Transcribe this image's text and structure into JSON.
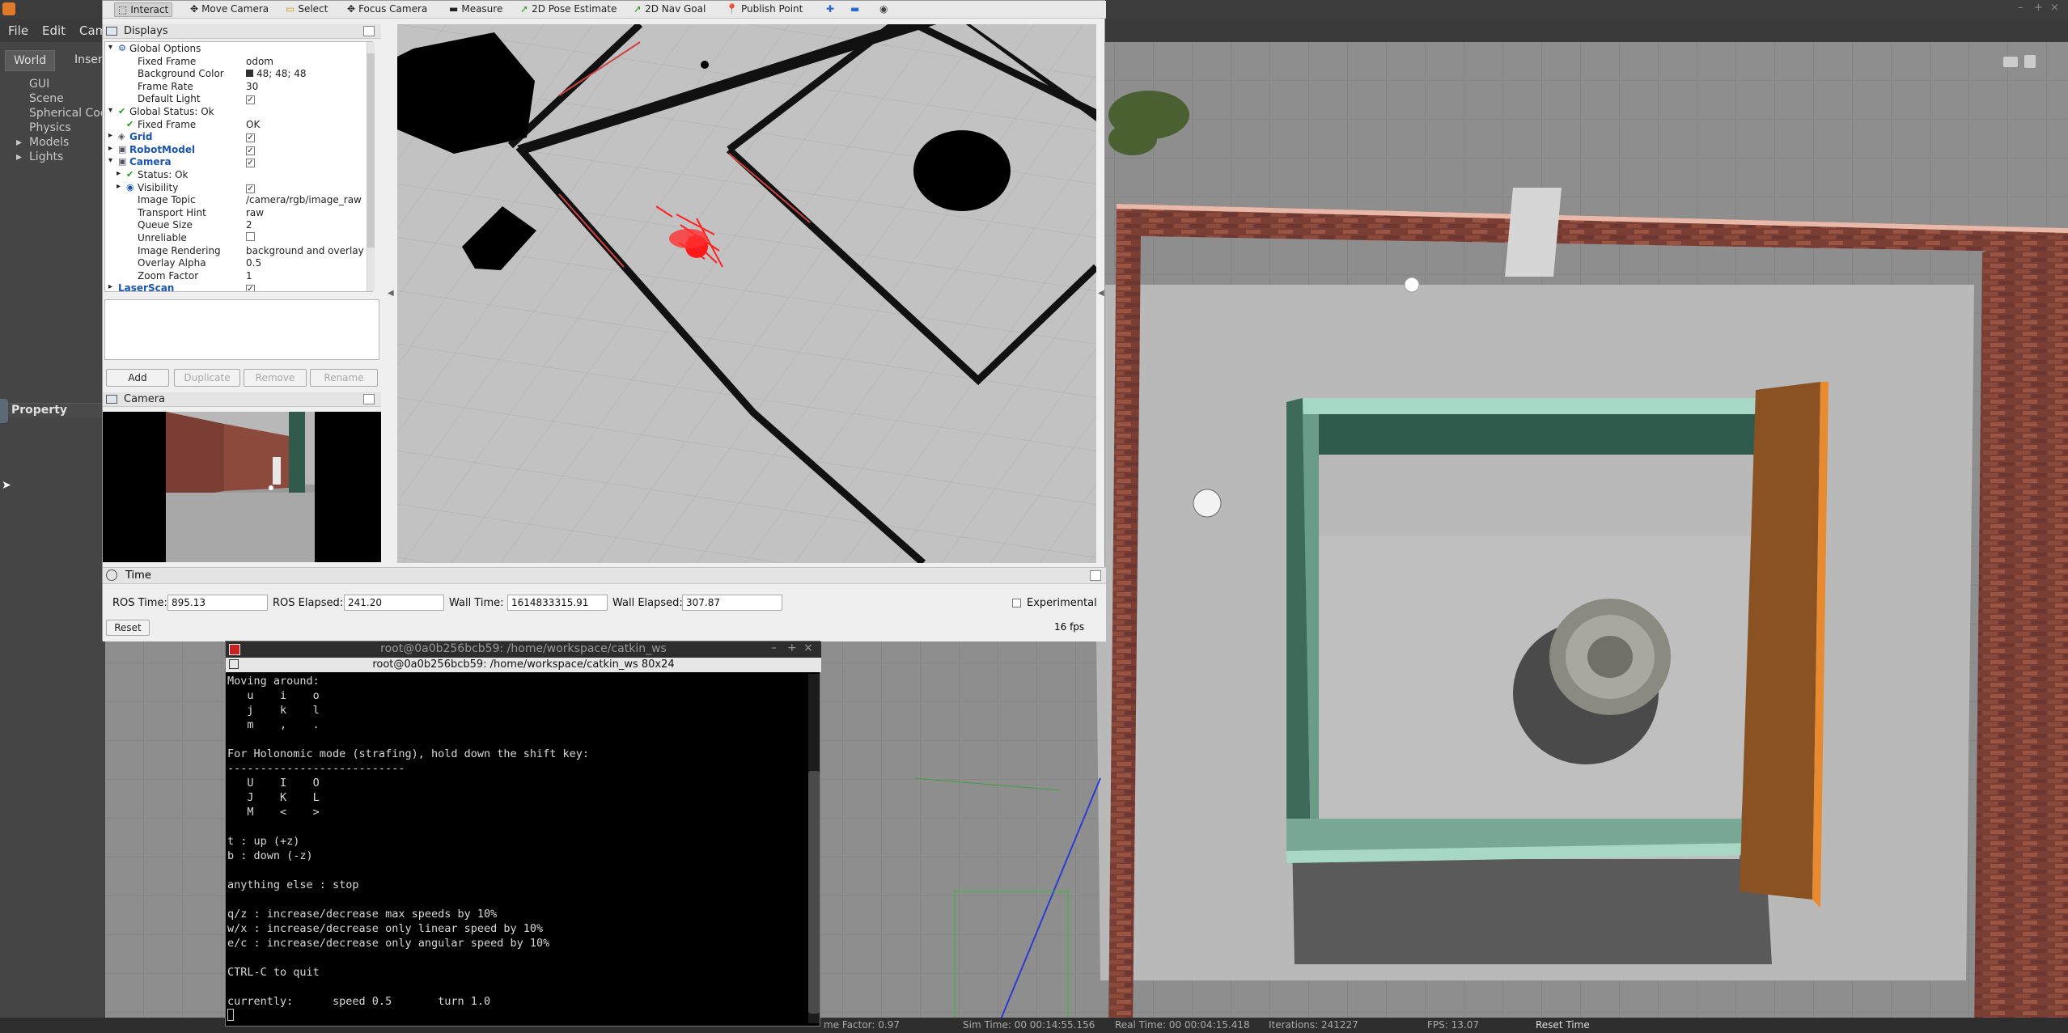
{
  "gazebo": {
    "menu": [
      "File",
      "Edit",
      "Cam"
    ],
    "tabs": [
      "World",
      "Inser"
    ],
    "tree": [
      "GUI",
      "Scene",
      "Spherical Coo",
      "Physics",
      "Models",
      "Lights"
    ],
    "property_label": "Property",
    "status": {
      "rtf": "me Factor:  0.97",
      "sim_time": "Sim Time:  00 00:14:55.156",
      "real_time": "Real Time:  00 00:04:15.418",
      "iterations": "Iterations:  241227",
      "fps": "FPS:  13.07",
      "reset": "Reset Time"
    }
  },
  "rviz": {
    "toolbar": [
      "Interact",
      "Move Camera",
      "Select",
      "Focus Camera",
      "Measure",
      "2D Pose Estimate",
      "2D Nav Goal",
      "Publish Point"
    ],
    "displays_title": "Displays",
    "tree": [
      {
        "k": "Global Options",
        "v": "",
        "indent": 1,
        "arrow": "▾",
        "icon": "gear"
      },
      {
        "k": "Fixed Frame",
        "v": "odom",
        "indent": 2
      },
      {
        "k": "Background Color",
        "v": "48; 48; 48",
        "indent": 2,
        "swatch": true
      },
      {
        "k": "Frame Rate",
        "v": "30",
        "indent": 2
      },
      {
        "k": "Default Light",
        "v": "✓",
        "indent": 2,
        "check": true
      },
      {
        "k": "Global Status: Ok",
        "v": "",
        "indent": 1,
        "arrow": "▾",
        "icon": "ok"
      },
      {
        "k": "Fixed Frame",
        "v": "OK",
        "indent": 2,
        "icon": "ok"
      },
      {
        "k": "Grid",
        "v": "✓",
        "indent": 1,
        "arrow": "▸",
        "icon": "grid",
        "blue": true,
        "check": true
      },
      {
        "k": "RobotModel",
        "v": "✓",
        "indent": 1,
        "arrow": "▸",
        "icon": "robot",
        "blue": true,
        "check": true
      },
      {
        "k": "Camera",
        "v": "✓",
        "indent": 1,
        "arrow": "▾",
        "icon": "camera",
        "blue": true,
        "check": true
      },
      {
        "k": "Status: Ok",
        "v": "",
        "indent": 2,
        "arrow": "▸",
        "icon": "ok"
      },
      {
        "k": "Visibility",
        "v": "✓",
        "indent": 2,
        "arrow": "▸",
        "icon": "eye",
        "check": true
      },
      {
        "k": "Image Topic",
        "v": "/camera/rgb/image_raw",
        "indent": 2
      },
      {
        "k": "Transport Hint",
        "v": "raw",
        "indent": 2
      },
      {
        "k": "Queue Size",
        "v": "2",
        "indent": 2
      },
      {
        "k": "Unreliable",
        "v": "",
        "indent": 2,
        "check": true
      },
      {
        "k": "Image Rendering",
        "v": "background and overlay",
        "indent": 2
      },
      {
        "k": "Overlay Alpha",
        "v": "0.5",
        "indent": 2
      },
      {
        "k": "Zoom Factor",
        "v": "1",
        "indent": 2
      },
      {
        "k": "LaserScan",
        "v": "✓",
        "indent": 1,
        "arrow": "▸",
        "blue": true,
        "check": true
      }
    ],
    "buttons": {
      "add": "Add",
      "duplicate": "Duplicate",
      "remove": "Remove",
      "rename": "Rename"
    },
    "camera_title": "Camera",
    "time": {
      "title": "Time",
      "ros_time_label": "ROS Time:",
      "ros_time": "895.13",
      "ros_elapsed_label": "ROS Elapsed:",
      "ros_elapsed": "241.20",
      "wall_time_label": "Wall Time:",
      "wall_time": "1614833315.91",
      "wall_elapsed_label": "Wall Elapsed:",
      "wall_elapsed": "307.87",
      "experimental": "Experimental",
      "reset": "Reset",
      "fps": "16 fps"
    }
  },
  "terminal": {
    "title": "root@0a0b256bcb59: /home/workspace/catkin_ws",
    "subtitle": "root@0a0b256bcb59: /home/workspace/catkin_ws 80x24",
    "lines": [
      "Moving around:",
      "   u    i    o",
      "   j    k    l",
      "   m    ,    .",
      "",
      "For Holonomic mode (strafing), hold down the shift key:",
      "---------------------------",
      "   U    I    O",
      "   J    K    L",
      "   M    <    >",
      "",
      "t : up (+z)",
      "b : down (-z)",
      "",
      "anything else : stop",
      "",
      "q/z : increase/decrease max speeds by 10%",
      "w/x : increase/decrease only linear speed by 10%",
      "e/c : increase/decrease only angular speed by 10%",
      "",
      "CTRL-C to quit",
      "",
      "currently:      speed 0.5       turn 1.0"
    ]
  }
}
